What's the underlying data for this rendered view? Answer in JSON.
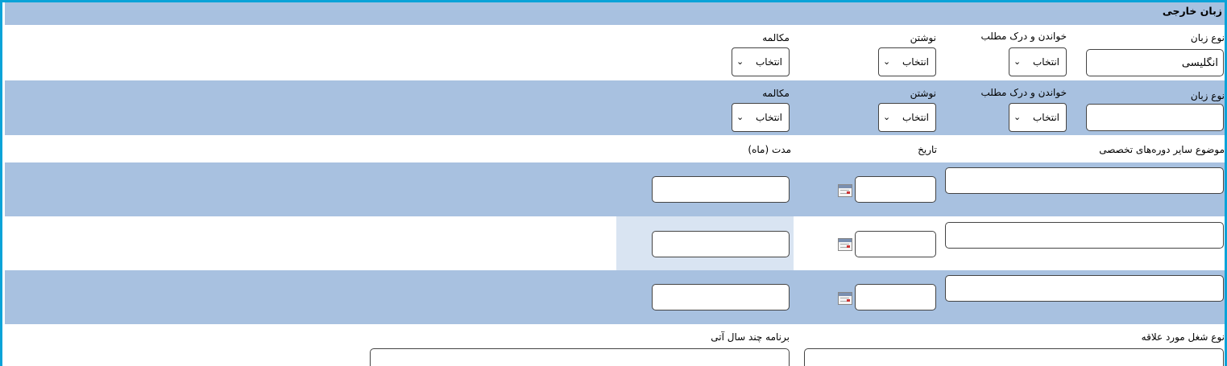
{
  "section_title": "زبان خارجی",
  "language_rows": [
    {
      "language_label": "نوع زبان",
      "language_value": "انگلیسی",
      "reading_label": "خواندن و درک مطلب",
      "reading_value": "انتخاب",
      "writing_label": "نوشتن",
      "writing_value": "انتخاب",
      "speaking_label": "مکالمه",
      "speaking_value": "انتخاب"
    },
    {
      "language_label": "نوع زبان",
      "language_value": "",
      "reading_label": "خواندن و درک مطلب",
      "reading_value": "انتخاب",
      "writing_label": "نوشتن",
      "writing_value": "انتخاب",
      "speaking_label": "مکالمه",
      "speaking_value": "انتخاب"
    }
  ],
  "courses": {
    "subject_label": "موضوع سایر دوره‌های تخصصی",
    "date_label": "تاریخ",
    "duration_label": "مدت (ماه)",
    "rows": [
      {
        "subject": "",
        "date": "",
        "duration": ""
      },
      {
        "subject": "",
        "date": "",
        "duration": ""
      },
      {
        "subject": "",
        "date": "",
        "duration": ""
      }
    ]
  },
  "interest": {
    "job_label": "نوع شغل مورد علاقه",
    "plan_label": "برنامه چند سال آتی",
    "job_value": "",
    "plan_value": ""
  },
  "colors": {
    "band": "#a8c1e0",
    "frame": "#0aa3d8",
    "highlight": "#d9e4f2"
  },
  "icons": {
    "select_arrow": "chevron-down-icon",
    "date_picker": "calendar-icon"
  }
}
